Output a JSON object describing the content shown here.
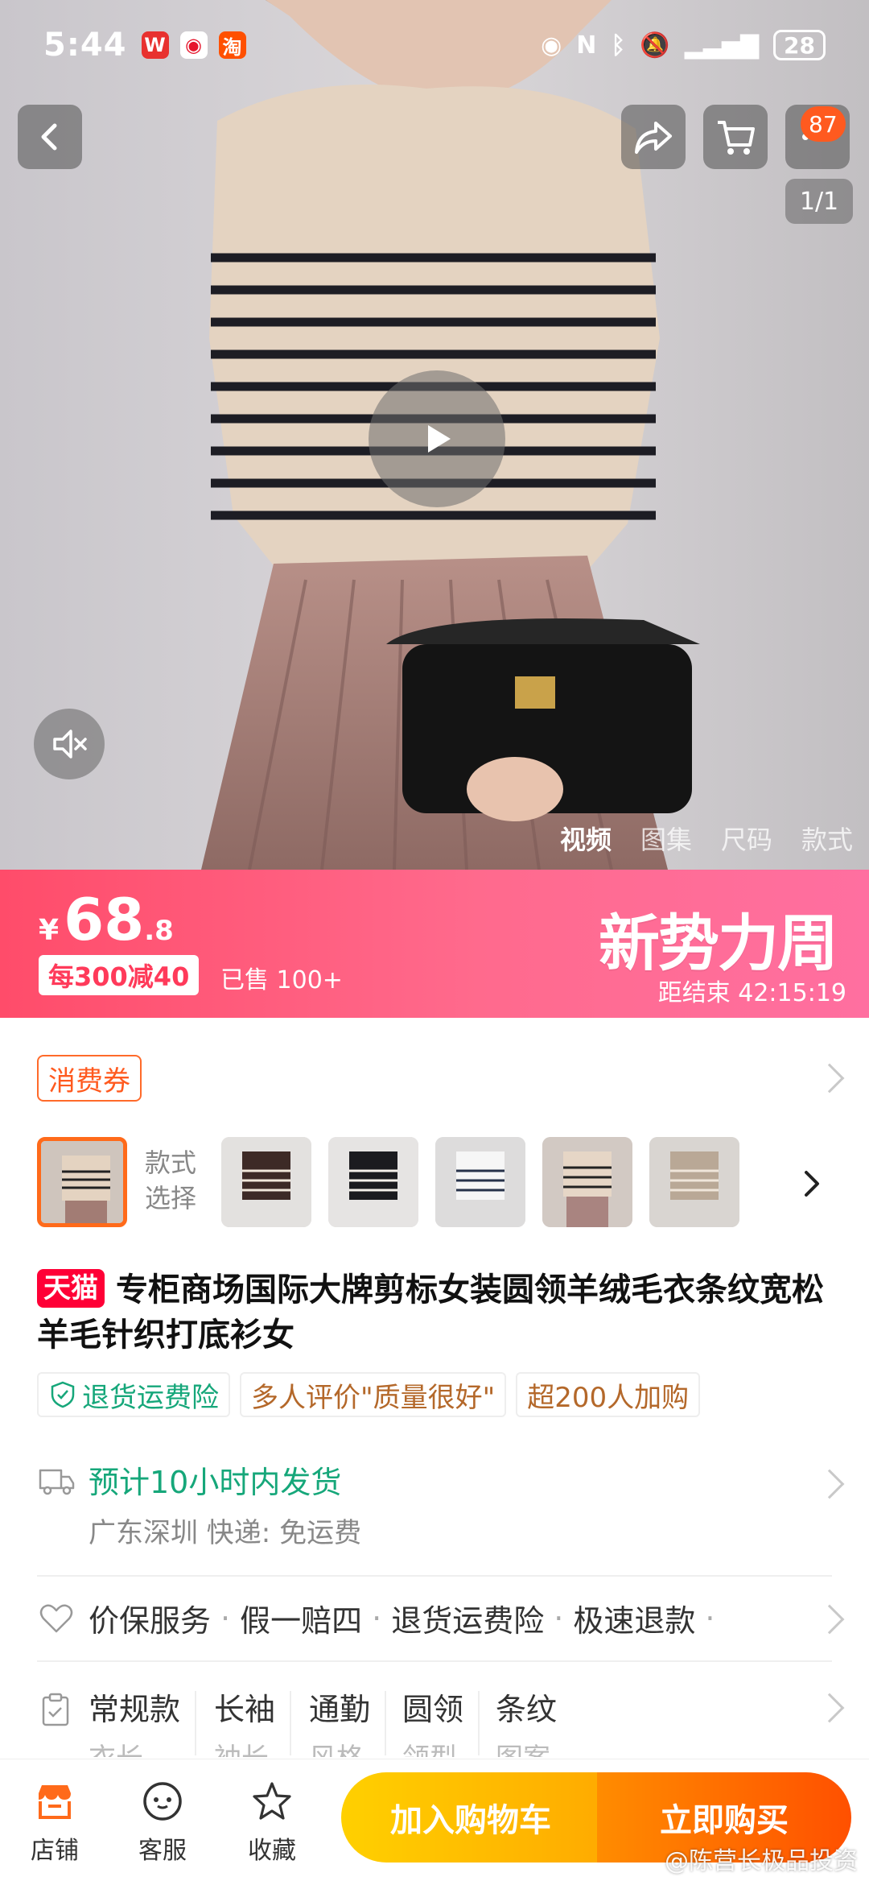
{
  "status_bar": {
    "time": "5:44",
    "battery": "28"
  },
  "top": {
    "cart_badge": "87",
    "image_counter": "1/1"
  },
  "media_tabs": [
    "视频",
    "图集",
    "尺码",
    "款式"
  ],
  "price": {
    "currency": "¥",
    "integer": "68",
    "decimal": ".8",
    "promo": "每300减40",
    "sold": "已售 100+",
    "event_logo": "新势力周",
    "countdown": "距结束 42:15:19"
  },
  "coupon": "消费券",
  "variant": {
    "label": "款式选择"
  },
  "product": {
    "tmall_tag": "天猫",
    "title": "专柜商场国际大牌剪标女装圆领羊绒毛衣条纹宽松羊毛针织打底衫女"
  },
  "feature_tags": [
    "退货运费险",
    "多人评价\"质量很好\"",
    "超200人加购"
  ],
  "shipping": {
    "title": "预计10小时内发货",
    "subtitle": "广东深圳  快递:  免运费"
  },
  "services": [
    "价保服务",
    "假一赔四",
    "退货运费险",
    "极速退款"
  ],
  "params": [
    {
      "value": "常规款",
      "label": "衣长"
    },
    {
      "value": "长袖",
      "label": "袖长"
    },
    {
      "value": "通勤",
      "label": "风格"
    },
    {
      "value": "圆领",
      "label": "领型"
    },
    {
      "value": "条纹",
      "label": "图案"
    }
  ],
  "bottom_bar": {
    "shop": "店铺",
    "service": "客服",
    "favorite": "收藏",
    "add_to_cart": "加入购物车",
    "buy_now": "立即购买"
  },
  "watermark": "@陈营长极品投资",
  "colors": {
    "accent_orange": "#ff5000",
    "tmall_red": "#ff0036",
    "price_pink": "#ff4c6a",
    "ship_green": "#16a77a"
  }
}
